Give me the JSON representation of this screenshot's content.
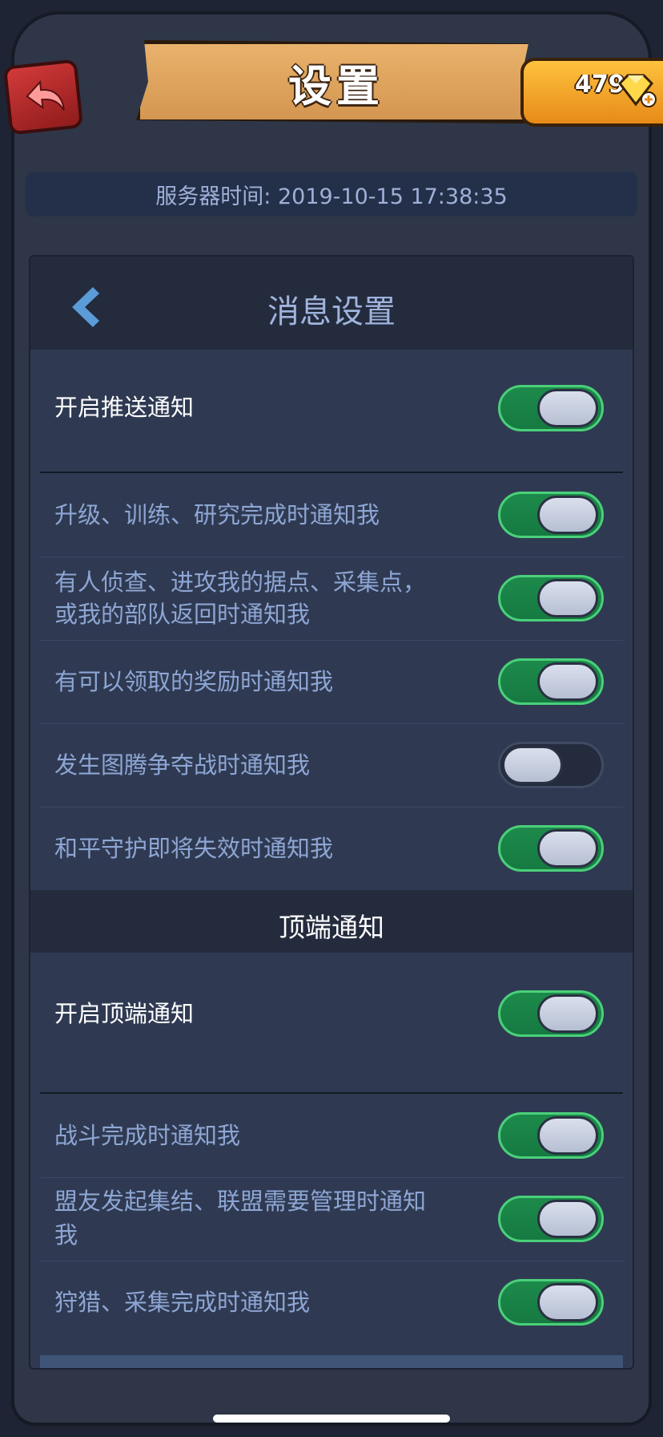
{
  "header": {
    "title": "设置",
    "gem_count": "479",
    "back_icon": "back-arrow-icon",
    "gem_icon": "gem-plus-icon"
  },
  "server": {
    "text": "服务器时间: 2019-10-15 17:38:35"
  },
  "panel": {
    "title": "消息设置",
    "back_icon": "chevron-left-icon",
    "push": {
      "label": "开启推送通知",
      "enabled": true
    },
    "push_items": [
      {
        "label": "升级、训练、研究完成时通知我",
        "enabled": true
      },
      {
        "label": "有人侦查、进攻我的据点、采集点，",
        "label2": "或我的部队返回时通知我",
        "enabled": true
      },
      {
        "label": "有可以领取的奖励时通知我",
        "enabled": true
      },
      {
        "label": "发生图腾争夺战时通知我",
        "enabled": false
      },
      {
        "label": "和平守护即将失效时通知我",
        "enabled": true
      }
    ],
    "top_section_title": "顶端通知",
    "top": {
      "label": "开启顶端通知",
      "enabled": true
    },
    "top_items": [
      {
        "label": "战斗完成时通知我",
        "enabled": true
      },
      {
        "label": "盟友发起集结、联盟需要管理时通知",
        "label2": "我",
        "enabled": true
      },
      {
        "label": "狩猎、采集完成时通知我",
        "enabled": true
      }
    ]
  },
  "colors": {
    "toggle_on": "#1c8a4b",
    "toggle_off": "#242b3d",
    "label_secondary": "#8ea6d4",
    "plaque": "#e0a55c",
    "gem_bar": "#f5a82a"
  }
}
